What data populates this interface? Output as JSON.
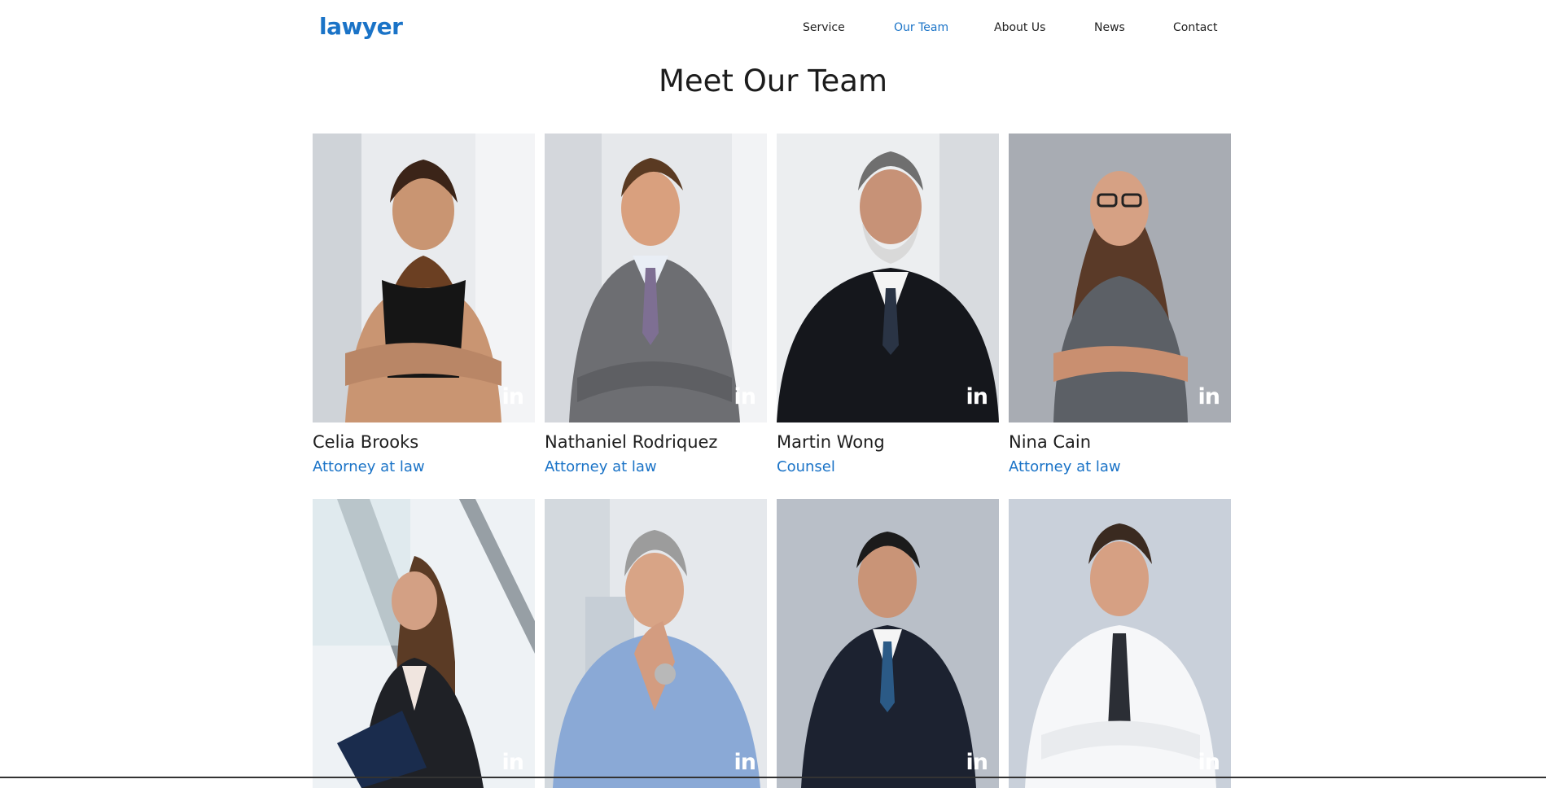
{
  "brand": {
    "logo": "lawyer",
    "accent_color": "#1a73c7"
  },
  "nav": {
    "items": [
      {
        "label": "Service",
        "active": false
      },
      {
        "label": "Our Team",
        "active": true
      },
      {
        "label": "About Us",
        "active": false
      },
      {
        "label": "News",
        "active": false
      },
      {
        "label": "Contact",
        "active": false
      }
    ]
  },
  "page_title": "Meet Our Team",
  "team": [
    {
      "name": "Celia Brooks",
      "role": "Attorney at law",
      "social_icon": "linkedin-icon",
      "social_text": "in"
    },
    {
      "name": "Nathaniel Rodriquez",
      "role": "Attorney at law",
      "social_icon": "linkedin-icon",
      "social_text": "in"
    },
    {
      "name": "Martin Wong",
      "role": "Counsel",
      "social_icon": "linkedin-icon",
      "social_text": "in"
    },
    {
      "name": "Nina Cain",
      "role": "Attorney at law",
      "social_icon": "linkedin-icon",
      "social_text": "in"
    },
    {
      "name": "",
      "role": "",
      "social_icon": "linkedin-icon",
      "social_text": "in"
    },
    {
      "name": "",
      "role": "",
      "social_icon": "linkedin-icon",
      "social_text": "in"
    },
    {
      "name": "",
      "role": "",
      "social_icon": "linkedin-icon",
      "social_text": "in"
    },
    {
      "name": "",
      "role": "",
      "social_icon": "linkedin-icon",
      "social_text": "in"
    }
  ]
}
